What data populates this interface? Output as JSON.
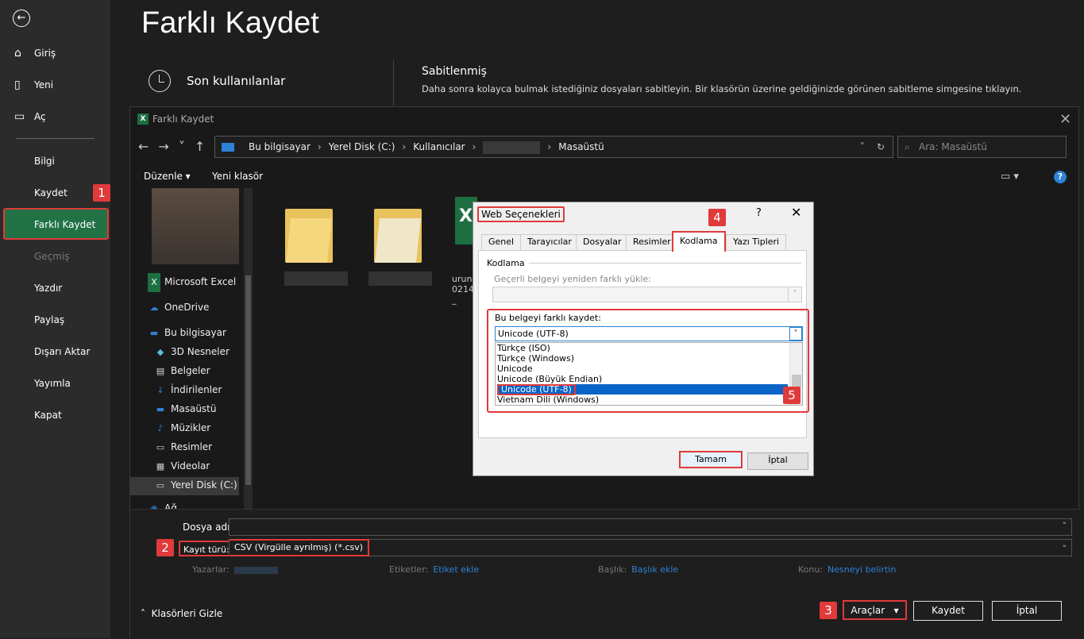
{
  "backstage": {
    "title": "Farklı Kaydet",
    "nav": [
      "Giriş",
      "Yeni",
      "Aç",
      "Bilgi",
      "Kaydet",
      "Farklı Kaydet",
      "Geçmiş",
      "Yazdır",
      "Paylaş",
      "Dışarı Aktar",
      "Yayımla",
      "Kapat"
    ],
    "recent": "Son kullanılanlar",
    "pinned_title": "Sabitlenmiş",
    "pinned_desc": "Daha sonra kolayca bulmak istediğiniz dosyaları sabitleyin. Bir klasörün üzerine geldiğinizde görünen sabitleme simgesine tıklayın."
  },
  "save_dialog": {
    "title": "Farklı Kaydet",
    "breadcrumb": [
      "Bu bilgisayar",
      "Yerel Disk (C:)",
      "Kullanıcılar",
      "Masaüstü"
    ],
    "search_placeholder": "Ara: Masaüstü",
    "organize": "Düzenle",
    "new_folder": "Yeni klasör",
    "tree": [
      "Microsoft Excel",
      "OneDrive",
      "Bu bilgisayar",
      "3D Nesneler",
      "Belgeler",
      "İndirilenler",
      "Masaüstü",
      "Müzikler",
      "Resimler",
      "Videolar",
      "Yerel Disk (C:)",
      "Ağ"
    ],
    "file_label": "urun 0214_",
    "file_name_label": "Dosya adı:",
    "file_name_value": "",
    "file_type_label": "Kayıt türü:",
    "file_type_value": "CSV (Virgülle ayrılmış) (*.csv)",
    "meta": [
      {
        "label": "Yazarlar:",
        "value": ""
      },
      {
        "label": "Etiketler:",
        "value": "Etiket ekle"
      },
      {
        "label": "Başlık:",
        "value": "Başlık ekle"
      },
      {
        "label": "Konu:",
        "value": "Nesneyi belirtin"
      }
    ],
    "hide_folders": "Klasörleri Gizle",
    "tools": "Araçlar",
    "save": "Kaydet",
    "cancel": "İptal"
  },
  "web_options": {
    "title": "Web Seçenekleri",
    "help": "?",
    "tabs": [
      "Genel",
      "Tarayıcılar",
      "Dosyalar",
      "Resimler",
      "Kodlama",
      "Yazı Tipleri"
    ],
    "group": "Kodlama",
    "reload_label": "Geçerli belgeyi yeniden farklı yükle:",
    "save_as_label": "Bu belgeyi farklı kaydet:",
    "selected": "Unicode (UTF-8)",
    "options": [
      "Türkçe (ISO)",
      "Türkçe (Windows)",
      "Unicode",
      "Unicode (Büyük Endian)",
      "Unicode (UTF-8)",
      "Vietnam Dili (Windows)"
    ],
    "ok": "Tamam",
    "cancel": "İptal"
  },
  "badges": [
    "1",
    "2",
    "3",
    "4",
    "5"
  ],
  "colors": {
    "accent_green": "#217346",
    "highlight_red": "#e03a3a",
    "link_blue": "#2c82d6"
  }
}
